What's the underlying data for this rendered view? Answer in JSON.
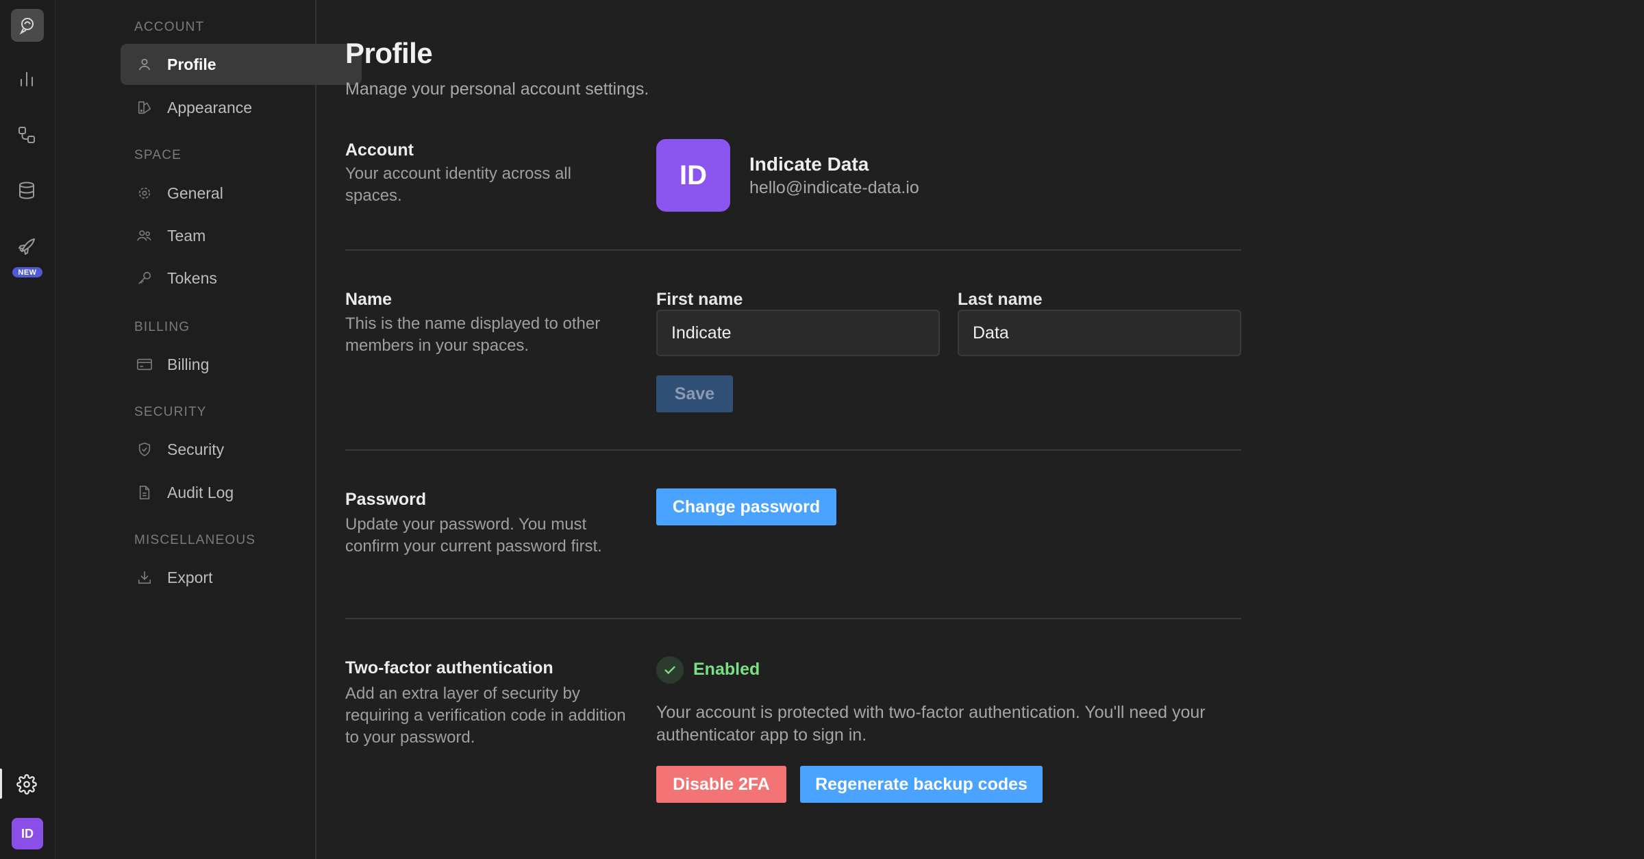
{
  "rail": {
    "new_badge": "NEW",
    "avatar_initials": "ID",
    "icons": [
      "logo-icon",
      "bar-chart-icon",
      "flow-icon",
      "database-icon",
      "rocket-icon",
      "gear-icon"
    ]
  },
  "sidebar": {
    "sections": {
      "account": "ACCOUNT",
      "space": "SPACE",
      "billing": "BILLING",
      "security": "SECURITY",
      "misc": "MISCELLANEOUS"
    },
    "items": {
      "profile": "Profile",
      "appearance": "Appearance",
      "general": "General",
      "team": "Team",
      "tokens": "Tokens",
      "billing": "Billing",
      "security": "Security",
      "audit_log": "Audit Log",
      "export": "Export"
    }
  },
  "main": {
    "title": "Profile",
    "subtitle": "Manage your personal account settings.",
    "account": {
      "title": "Account",
      "desc": "Your account identity across all spaces.",
      "initials": "ID",
      "name": "Indicate Data",
      "email": "hello@indicate-data.io"
    },
    "name": {
      "title": "Name",
      "desc": "This is the name displayed to other members in your spaces.",
      "first_label": "First name",
      "first_value": "Indicate",
      "last_label": "Last name",
      "last_value": "Data",
      "save": "Save"
    },
    "password": {
      "title": "Password",
      "desc": "Update your password. You must confirm your current password first.",
      "button": "Change password"
    },
    "twofa": {
      "title": "Two-factor authentication",
      "desc": "Add an extra layer of security by requiring a verification code in addition to your password.",
      "status": "Enabled",
      "info": "Your account is protected with two-factor authentication. You'll need your authenticator app to sign in.",
      "disable": "Disable 2FA",
      "regenerate": "Regenerate backup codes"
    }
  },
  "colors": {
    "accent_blue": "#4aa3ff",
    "danger_red": "#f27474",
    "avatar_purple": "#8b55f0",
    "success_green": "#7be083"
  }
}
